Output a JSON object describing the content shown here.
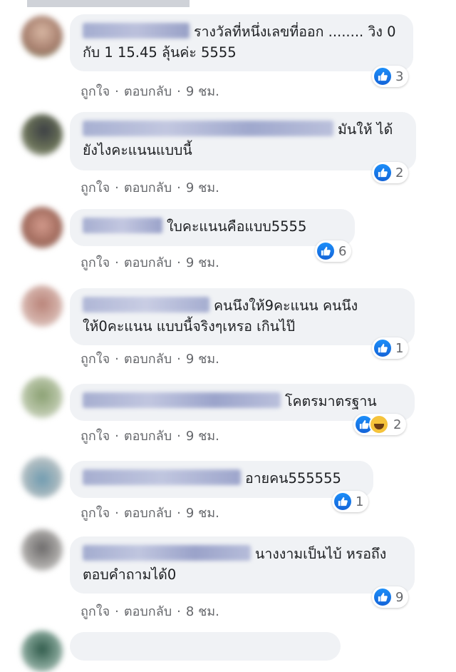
{
  "actions": {
    "like": "ถูกใจ",
    "reply": "ตอบกลับ",
    "sep": "·"
  },
  "comments": [
    {
      "text": "รางวัลที่หนึ่งเลขที่ออก ........ วิง 0 กับ 1 15.45 ลุ้นค่ะ 5555",
      "time": "9 ชม.",
      "reactions": "3"
    },
    {
      "text": "มันให้ ได้ยังไงคะแนนแบบนี้",
      "time": "9 ชม.",
      "reactions": "2"
    },
    {
      "text": "ใบคะแนนคือแบบ5555",
      "time": "9 ชม.",
      "reactions": "6"
    },
    {
      "text": "คนนึงให้9คะแนน คนนึง ให้0คะแนน แบบนี้จริงๆเหรอ เกินไป๊",
      "time": "9 ชม.",
      "reactions": "1"
    },
    {
      "text": "โคตรมาตรฐาน",
      "time": "9 ชม.",
      "reactions": "2"
    },
    {
      "text": "อายคน555555",
      "time": "9 ชม.",
      "reactions": "1"
    },
    {
      "text": "นางงามเป็นไบ้ หรอถึงตอบคำถามได้0",
      "time": "8 ชม.",
      "reactions": "9"
    }
  ],
  "colors": {
    "like_blue": "#1877f2",
    "bubble": "#f0f2f5",
    "meta": "#65676b"
  }
}
